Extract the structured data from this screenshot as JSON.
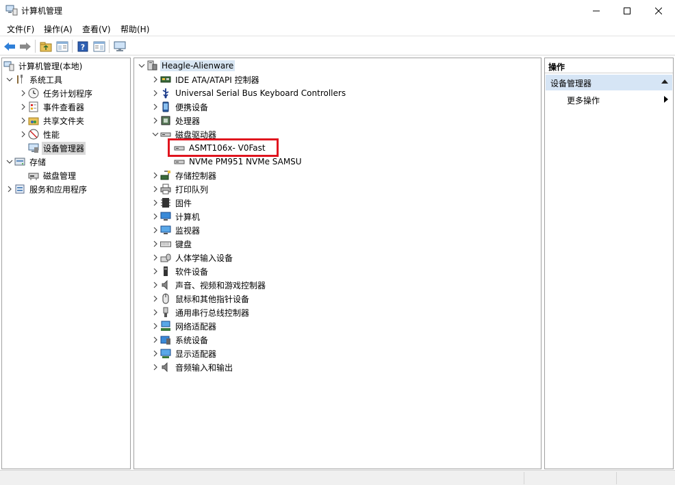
{
  "window": {
    "title": "计算机管理",
    "controls": {
      "minimize": "—",
      "maximize": "☐",
      "close": "✕"
    }
  },
  "menu": [
    {
      "label": "文件(F)"
    },
    {
      "label": "操作(A)"
    },
    {
      "label": "查看(V)"
    },
    {
      "label": "帮助(H)"
    }
  ],
  "toolbar": [
    {
      "icon": "back-arrow-icon"
    },
    {
      "icon": "forward-arrow-icon"
    },
    {
      "icon": "folder-up-icon"
    },
    {
      "icon": "show-hide-tree-icon"
    },
    {
      "icon": "help-icon"
    },
    {
      "icon": "show-hide-action-pane-icon"
    },
    {
      "icon": "monitor-icon"
    }
  ],
  "left_tree": [
    {
      "label": "计算机管理(本地)",
      "icon": "computer-management-icon"
    },
    {
      "label": "系统工具",
      "icon": "tools-icon"
    },
    {
      "label": "任务计划程序",
      "icon": "clock-icon"
    },
    {
      "label": "事件查看器",
      "icon": "event-viewer-icon"
    },
    {
      "label": "共享文件夹",
      "icon": "shared-folder-icon"
    },
    {
      "label": "性能",
      "icon": "performance-icon"
    },
    {
      "label": "设备管理器",
      "icon": "device-manager-icon",
      "selected": true
    },
    {
      "label": "存储",
      "icon": "storage-icon"
    },
    {
      "label": "磁盘管理",
      "icon": "disk-management-icon"
    },
    {
      "label": "服务和应用程序",
      "icon": "services-icon"
    }
  ],
  "device_tree": {
    "root": {
      "label": "Heagle-Alienware",
      "icon": "computer-icon"
    },
    "items": [
      {
        "label": "IDE ATA/ATAPI 控制器",
        "icon": "ide-controller-icon"
      },
      {
        "label": "Universal Serial Bus Keyboard Controllers",
        "icon": "usb-icon"
      },
      {
        "label": "便携设备",
        "icon": "portable-device-icon"
      },
      {
        "label": "处理器",
        "icon": "processor-icon"
      },
      {
        "label": "磁盘驱动器",
        "icon": "disk-drive-icon",
        "expanded": true
      },
      {
        "label": "ASMT106x- V0Fast",
        "icon": "disk-drive-icon",
        "child": true
      },
      {
        "label": "NVMe PM951 NVMe SAMSU",
        "icon": "disk-drive-icon",
        "child": true
      },
      {
        "label": "存储控制器",
        "icon": "storage-controller-icon"
      },
      {
        "label": "打印队列",
        "icon": "printer-icon"
      },
      {
        "label": "固件",
        "icon": "firmware-icon"
      },
      {
        "label": "计算机",
        "icon": "computer-icon"
      },
      {
        "label": "监视器",
        "icon": "monitor-icon"
      },
      {
        "label": "键盘",
        "icon": "keyboard-icon"
      },
      {
        "label": "人体学输入设备",
        "icon": "hid-icon"
      },
      {
        "label": "软件设备",
        "icon": "software-device-icon"
      },
      {
        "label": "声音、视频和游戏控制器",
        "icon": "speaker-icon"
      },
      {
        "label": "鼠标和其他指针设备",
        "icon": "mouse-icon"
      },
      {
        "label": "通用串行总线控制器",
        "icon": "usb-plug-icon"
      },
      {
        "label": "网络适配器",
        "icon": "network-adapter-icon"
      },
      {
        "label": "系统设备",
        "icon": "system-device-icon"
      },
      {
        "label": "显示适配器",
        "icon": "display-adapter-icon"
      },
      {
        "label": "音频输入和输出",
        "icon": "audio-io-icon"
      }
    ]
  },
  "actions": {
    "header": "操作",
    "section": "设备管理器",
    "more": "更多操作"
  },
  "colors": {
    "highlight": "#e0141e",
    "action_section_bg": "#d6e5f5",
    "selection_bg": "#d9d9d9"
  }
}
